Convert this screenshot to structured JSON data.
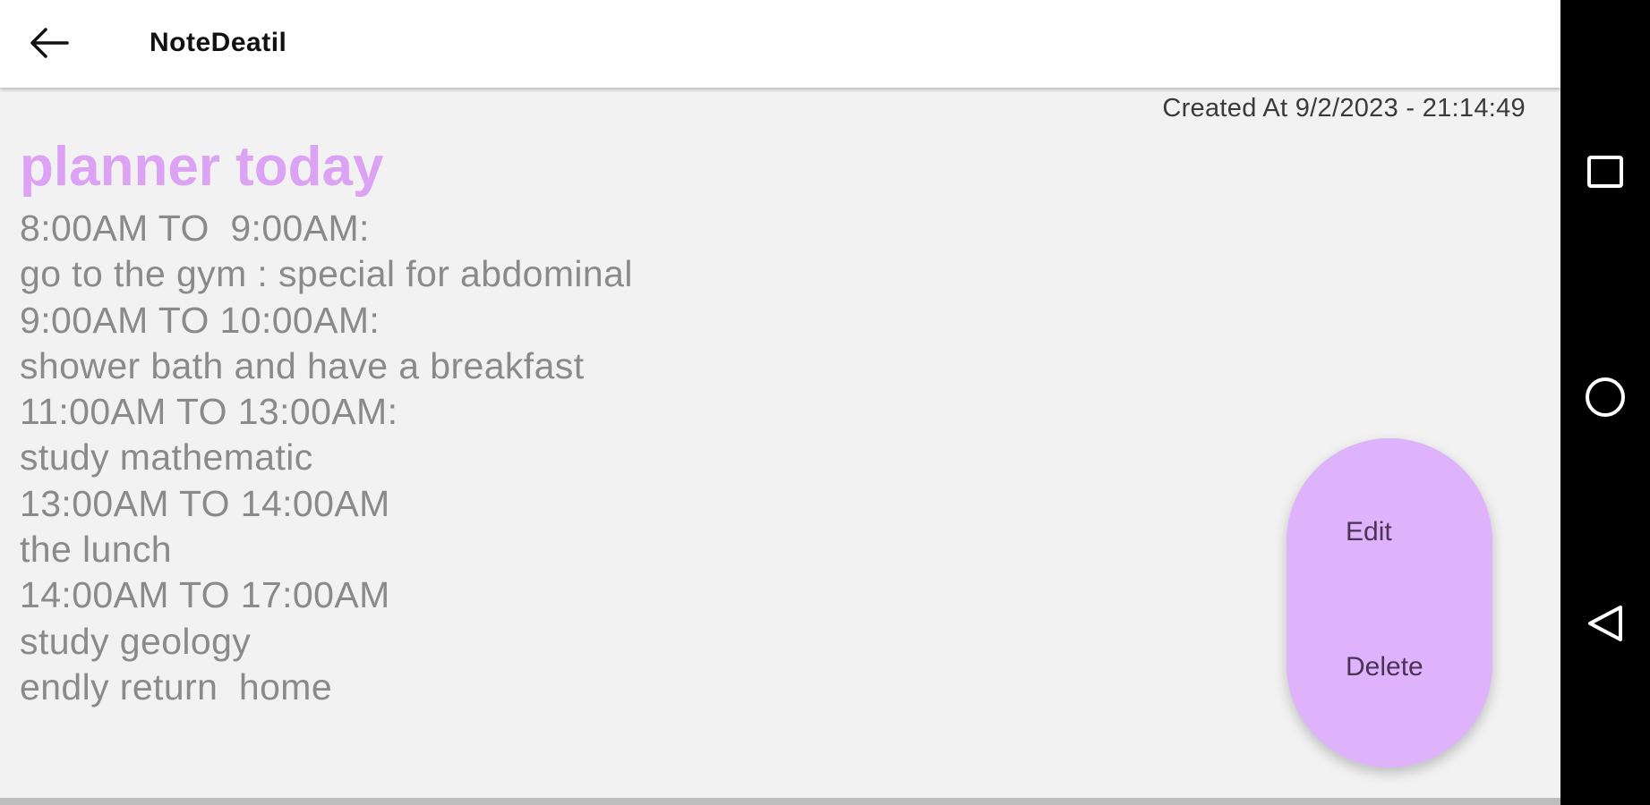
{
  "app_bar": {
    "title": "NoteDeatil",
    "back_icon": "arrow-left-icon"
  },
  "note": {
    "created_at": "Created At 9/2/2023 - 21:14:49",
    "title": "planner today",
    "lines": [
      "8:00AM TO  9:00AM:",
      "go to the gym : special for abdominal",
      "9:00AM TO 10:00AM:",
      "shower bath and have a breakfast",
      "11:00AM TO 13:00AM:",
      "study mathematic",
      "13:00AM TO 14:00AM",
      "the lunch",
      "14:00AM TO 17:00AM",
      "study geology",
      "endly return  home"
    ]
  },
  "actions": {
    "edit_label": "Edit",
    "delete_label": "Delete"
  },
  "system_nav": {
    "recents_icon": "square-recents-icon",
    "home_icon": "circle-home-icon",
    "back_icon": "triangle-back-icon"
  },
  "colors": {
    "accent": "#dca2f4",
    "pill": "#dfb3fb",
    "body_text": "#8a8a8a",
    "background": "#f2f2f2"
  }
}
